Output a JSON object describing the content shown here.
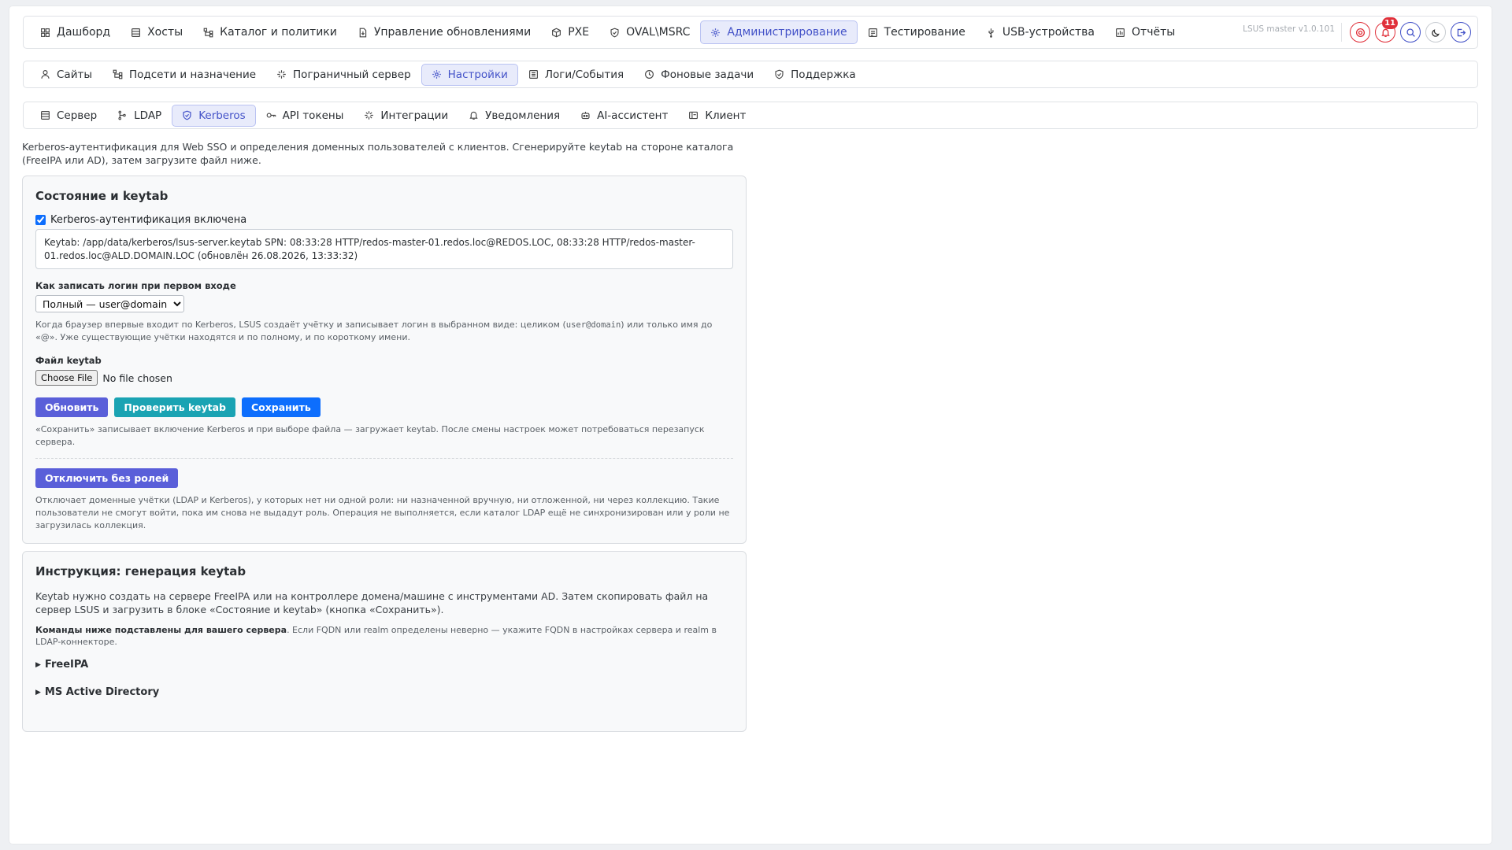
{
  "top_nav": {
    "items": [
      {
        "label": "Дашборд",
        "icon": "grid-icon"
      },
      {
        "label": "Хосты",
        "icon": "server-icon"
      },
      {
        "label": "Каталог и политики",
        "icon": "tree-icon"
      },
      {
        "label": "Управление обновлениями",
        "icon": "file-update-icon"
      },
      {
        "label": "PXE",
        "icon": "box-icon"
      },
      {
        "label": "OVAL\\MSRC",
        "icon": "shield-check-icon"
      },
      {
        "label": "Администрирование",
        "icon": "admin-gear-icon",
        "active": true
      },
      {
        "label": "Тестирование",
        "icon": "test-icon"
      },
      {
        "label": "USB-устройства",
        "icon": "usb-icon"
      },
      {
        "label": "Отчёты",
        "icon": "report-icon"
      }
    ],
    "version": "LSUS master v1.0.101",
    "notification_count": "11"
  },
  "admin_nav": {
    "items": [
      {
        "label": "Сайты",
        "icon": "user-icon"
      },
      {
        "label": "Подсети и назначение",
        "icon": "tree-icon"
      },
      {
        "label": "Пограничный сервер",
        "icon": "spark-icon"
      },
      {
        "label": "Настройки",
        "icon": "gear-icon",
        "active": true
      },
      {
        "label": "Логи/События",
        "icon": "log-icon"
      },
      {
        "label": "Фоновые задачи",
        "icon": "clock-icon"
      },
      {
        "label": "Поддержка",
        "icon": "shield-icon"
      }
    ]
  },
  "settings_nav": {
    "items": [
      {
        "label": "Сервер",
        "icon": "server-icon"
      },
      {
        "label": "LDAP",
        "icon": "ldap-icon"
      },
      {
        "label": "Kerberos",
        "icon": "shield-icon",
        "active": true
      },
      {
        "label": "API токены",
        "icon": "key-icon"
      },
      {
        "label": "Интеграции",
        "icon": "spark-icon"
      },
      {
        "label": "Уведомления",
        "icon": "bell-icon"
      },
      {
        "label": "AI-ассистент",
        "icon": "robot-icon"
      },
      {
        "label": "Клиент",
        "icon": "client-icon"
      }
    ]
  },
  "intro": "Kerberos-аутентификация для Web SSO и определения доменных пользователей с клиентов. Сгенерируйте keytab на стороне каталога (FreeIPA или AD), затем загрузите файл ниже.",
  "status_card": {
    "title": "Состояние и keytab",
    "enabled_label": "Kerberos-аутентификация включена",
    "keytab_info": "Keytab: /app/data/kerberos/lsus-server.keytab SPN: 08:33:28 HTTP/redos-master-01.redos.loc@REDOS.LOC, 08:33:28 HTTP/redos-master-01.redos.loc@ALD.DOMAIN.LOC (обновлён 26.08.2026, 13:33:32)",
    "login_label": "Как записать логин при первом входе",
    "login_selected": "Полный — user@domain",
    "login_hint_1": "Когда браузер впервые входит по Kerberos, LSUS создаёт учётку и записывает логин в выбранном виде: целиком (",
    "login_hint_code": "user@domain",
    "login_hint_2": ") или только имя до «@». Уже существующие учётки находятся и по полному, и по короткому имени.",
    "file_label": "Файл keytab",
    "file_button": "Choose File",
    "file_status": "No file chosen",
    "btn_refresh": "Обновить",
    "btn_check": "Проверить keytab",
    "btn_save": "Сохранить",
    "save_hint": "«Сохранить» записывает включение Kerberos и при выборе файла — загружает keytab. После смены настроек может потребоваться перезапуск сервера.",
    "btn_disable": "Отключить без ролей",
    "disable_hint": "Отключает доменные учётки (LDAP и Kerberos), у которых нет ни одной роли: ни назначенной вручную, ни отложенной, ни через коллекцию. Такие пользователи не смогут войти, пока им снова не выдадут роль. Операция не выполняется, если каталог LDAP ещё не синхронизирован или у роли не загрузилась коллекция."
  },
  "guide_card": {
    "title": "Инструкция: генерация keytab",
    "text": "Keytab нужно создать на сервере FreeIPA или на контроллере домена/машине с инструментами AD. Затем скопировать файл на сервер LSUS и загрузить в блоке «Состояние и keytab» (кнопка «Сохранить»).",
    "note_bold": "Команды ниже подставлены для вашего сервера",
    "note_rest": ". Если FQDN или realm определены неверно — укажите FQDN в настройках сервера и realm в LDAP-коннекторе.",
    "sections": [
      "FreeIPA",
      "MS Active Directory"
    ]
  },
  "colors": {
    "accent": "#4352c8",
    "active_bg": "#e8ebfb",
    "btn_indigo": "#5a5fd9",
    "btn_teal": "#1aa3b3",
    "btn_blue": "#0d6efd",
    "alert_red": "#e0303a"
  }
}
